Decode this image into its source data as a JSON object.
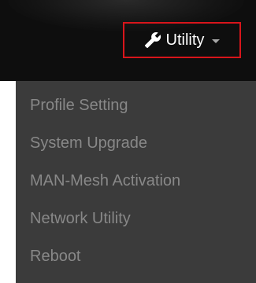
{
  "header": {
    "utility_label": "Utility",
    "utility_icon": "wrench-icon",
    "highlight_color": "#d8151b"
  },
  "menu": {
    "items": [
      {
        "label": "Profile Setting"
      },
      {
        "label": "System Upgrade"
      },
      {
        "label": "MAN-Mesh Activation"
      },
      {
        "label": "Network Utility"
      },
      {
        "label": "Reboot"
      }
    ]
  }
}
